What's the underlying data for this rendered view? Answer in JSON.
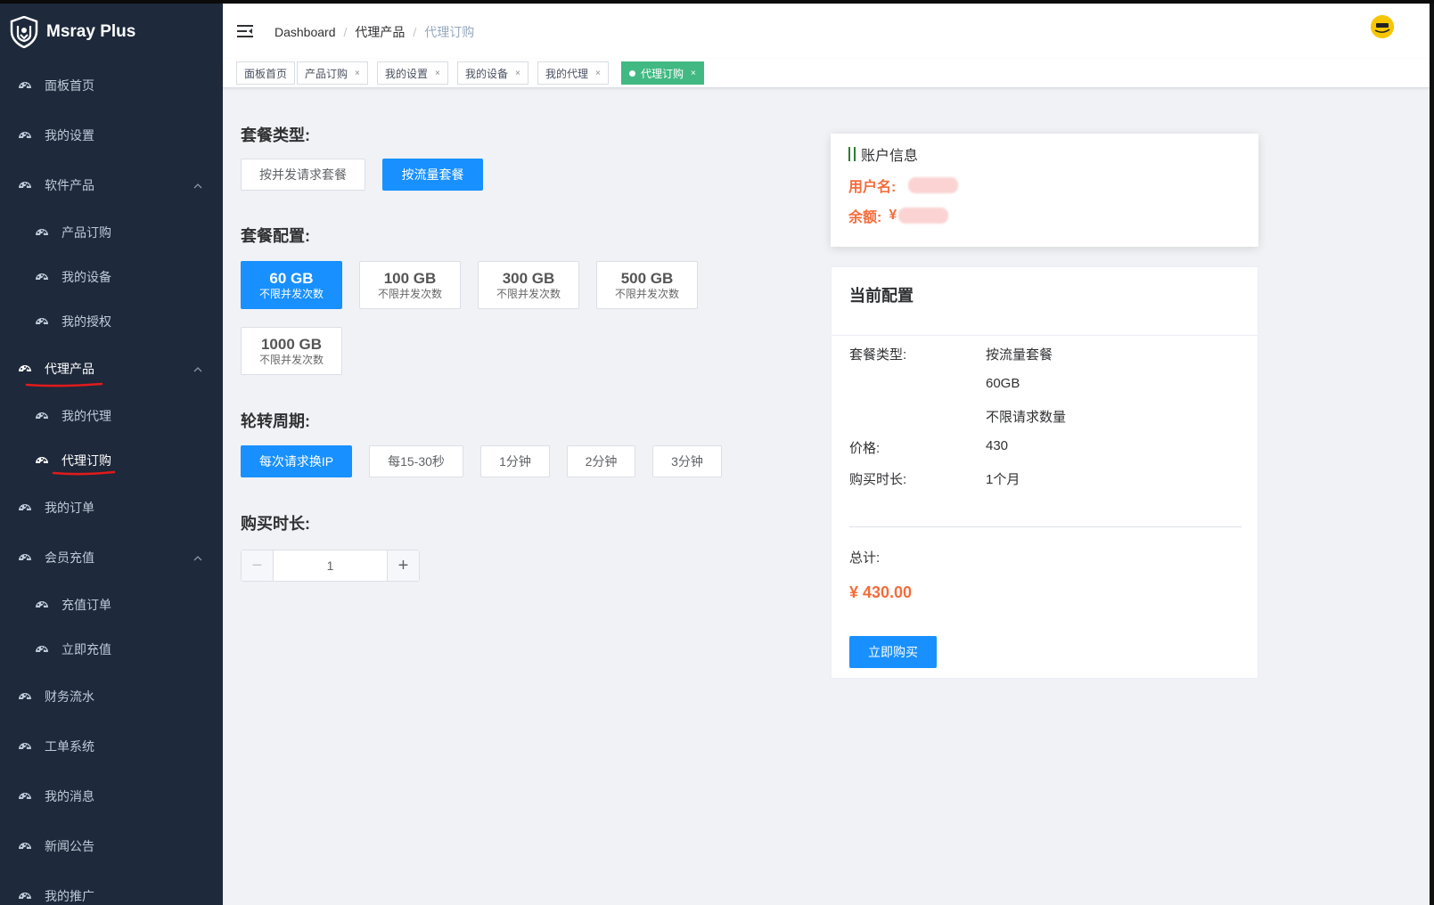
{
  "app": {
    "title": "Msray Plus"
  },
  "sidebar": {
    "items": [
      {
        "label": "面板首页"
      },
      {
        "label": "我的设置"
      },
      {
        "label": "软件产品"
      },
      {
        "label": "产品订购"
      },
      {
        "label": "我的设备"
      },
      {
        "label": "我的授权"
      },
      {
        "label": "代理产品"
      },
      {
        "label": "我的代理"
      },
      {
        "label": "代理订购"
      },
      {
        "label": "我的订单"
      },
      {
        "label": "会员充值"
      },
      {
        "label": "充值订单"
      },
      {
        "label": "立即充值"
      },
      {
        "label": "财务流水"
      },
      {
        "label": "工单系统"
      },
      {
        "label": "我的消息"
      },
      {
        "label": "新闻公告"
      },
      {
        "label": "我的推广"
      }
    ]
  },
  "breadcrumb": {
    "home": "Dashboard",
    "parent": "代理产品",
    "current": "代理订购"
  },
  "tags": [
    {
      "label": "面板首页"
    },
    {
      "label": "产品订购"
    },
    {
      "label": "我的设置"
    },
    {
      "label": "我的设备"
    },
    {
      "label": "我的代理"
    },
    {
      "label": "代理订购"
    }
  ],
  "tag_close": "×",
  "form": {
    "package_type_title": "套餐类型:",
    "package_types": [
      "按并发请求套餐",
      "按流量套餐"
    ],
    "package_config_title": "套餐配置:",
    "configs": [
      {
        "size": "60 GB",
        "desc": "不限并发次数"
      },
      {
        "size": "100 GB",
        "desc": "不限并发次数"
      },
      {
        "size": "300 GB",
        "desc": "不限并发次数"
      },
      {
        "size": "500 GB",
        "desc": "不限并发次数"
      },
      {
        "size": "1000 GB",
        "desc": "不限并发次数"
      }
    ],
    "rotation_title": "轮转周期:",
    "rotations": [
      "每次请求换IP",
      "每15-30秒",
      "1分钟",
      "2分钟",
      "3分钟"
    ],
    "duration_title": "购买时长:",
    "duration_value": "1",
    "minus": "−",
    "plus": "+"
  },
  "account": {
    "title": "账户信息",
    "username_label": "用户名:",
    "balance_label": "余额:",
    "currency": "¥"
  },
  "current_config": {
    "title": "当前配置",
    "type_label": "套餐类型:",
    "type_value": "按流量套餐",
    "size_value": "60GB",
    "limit_value": "不限请求数量",
    "price_label": "价格:",
    "price_value": "430",
    "duration_label": "购买时长:",
    "duration_value": "1个月",
    "total_label": "总计:",
    "total_value": "¥ 430.00",
    "buy_label": "立即购买"
  },
  "colors": {
    "sidebar_bg": "#1e293b",
    "primary": "#1890ff",
    "active_tag": "#42b983",
    "price": "#f56c3b",
    "annotation_red": "#e01b1b"
  }
}
